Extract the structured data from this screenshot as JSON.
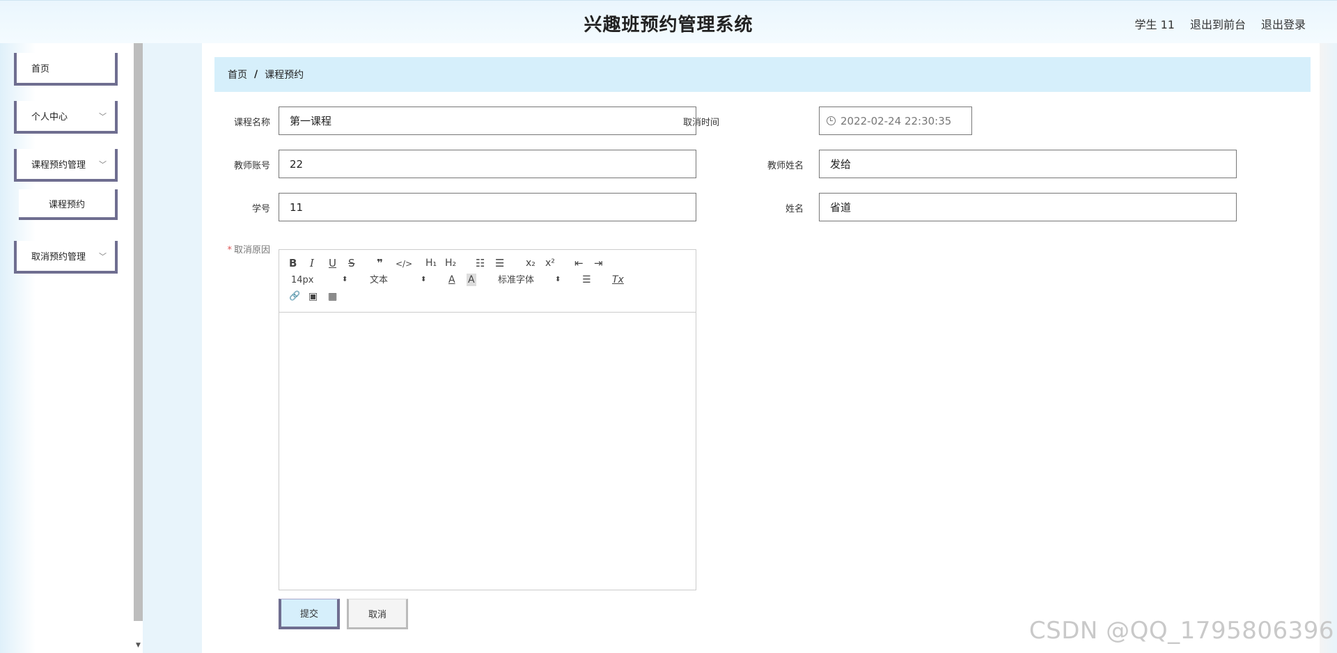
{
  "header": {
    "title": "兴趣班预约管理系统",
    "user": "学生 11",
    "link_front": "退出到前台",
    "link_logout": "退出登录"
  },
  "sidebar": {
    "items": [
      {
        "label": "首页"
      },
      {
        "label": "个人中心"
      },
      {
        "label": "课程预约管理"
      },
      {
        "label": "课程预约"
      },
      {
        "label": "取消预约管理"
      }
    ]
  },
  "breadcrumb": {
    "home": "首页",
    "separator": "/",
    "current": "课程预约"
  },
  "form": {
    "course_name_label": "课程名称",
    "course_name_value": "第一课程",
    "cancel_time_label": "取消时间",
    "cancel_time_value": "2022-02-24 22:30:35",
    "teacher_account_label": "教师账号",
    "teacher_account_value": "22",
    "teacher_name_label": "教师姓名",
    "teacher_name_value": "发给",
    "student_no_label": "学号",
    "student_no_value": "11",
    "name_label": "姓名",
    "name_value": "省道",
    "reason_required_mark": "*",
    "reason_label": "取消原因"
  },
  "editor": {
    "bold": "B",
    "italic": "I",
    "underline": "U",
    "strike": "S",
    "blockquote": "❞",
    "code": "</>",
    "h1": "H₁",
    "h2": "H₂",
    "ordered_list": "☷",
    "bullet_list": "☰",
    "subscript": "x₂",
    "superscript": "x²",
    "outdent": "⇤",
    "indent": "⇥",
    "font_size": "14px",
    "header_select": "文本",
    "font_color": "A",
    "background_color": "A",
    "font_family": "标准字体",
    "align": "☰",
    "clean": "Tx",
    "link": "🔗",
    "image": "▣",
    "video": "▦"
  },
  "buttons": {
    "submit": "提交",
    "cancel": "取消"
  },
  "watermark": "CSDN @QQ_1795806396"
}
